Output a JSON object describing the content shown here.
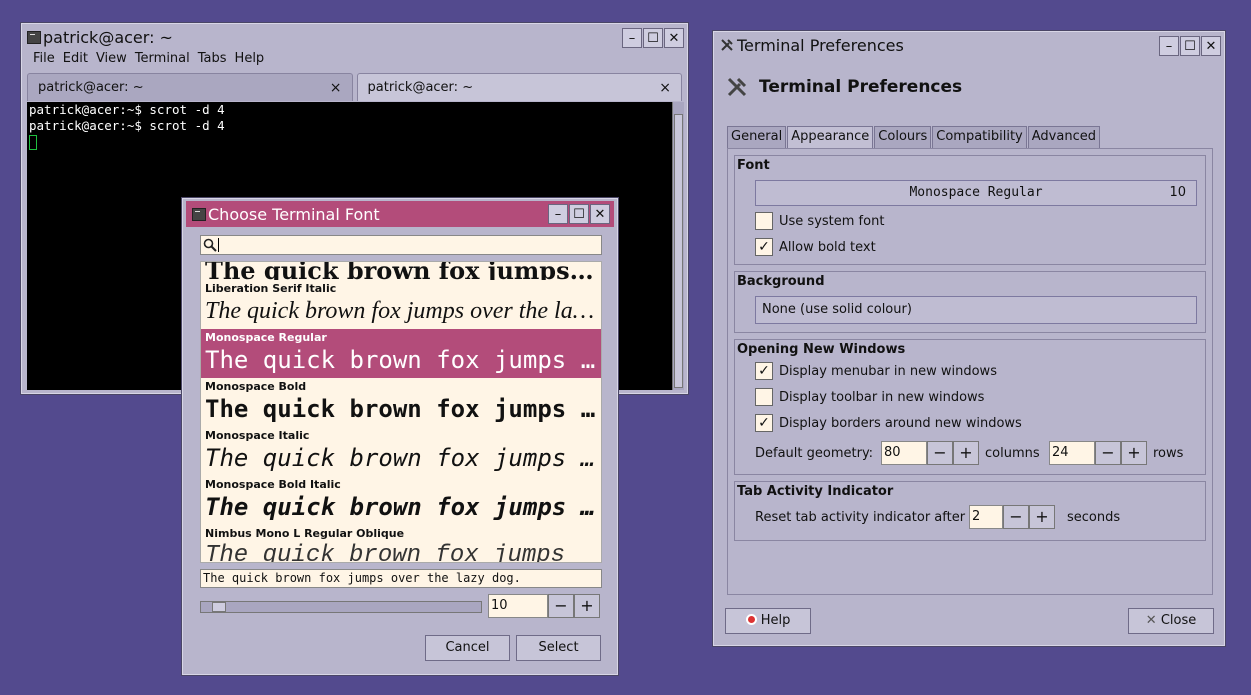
{
  "terminal": {
    "title": "patrick@acer: ~",
    "menu": [
      "File",
      "Edit",
      "View",
      "Terminal",
      "Tabs",
      "Help"
    ],
    "tabs": [
      {
        "label": "patrick@acer: ~",
        "close": "×"
      },
      {
        "label": "patrick@acer: ~",
        "close": "×"
      }
    ],
    "lines": [
      "patrick@acer:~$ scrot -d 4",
      "patrick@acer:~$ scrot -d 4"
    ]
  },
  "window_buttons": {
    "minimize": "–",
    "maximize": "☐",
    "close": "✕"
  },
  "font_chooser": {
    "title": "Choose Terminal Font",
    "search_value": "",
    "fonts": [
      {
        "name": "",
        "sample": "The quick brown fox jumps over the lazy dog"
      },
      {
        "name": "Liberation Serif Italic",
        "sample": "The quick brown fox jumps over the lazy dog"
      },
      {
        "name": "Monospace Regular",
        "sample": "The quick brown fox jumps over the lazy dog"
      },
      {
        "name": "Monospace Bold",
        "sample": "The quick brown fox jumps over the lazy dog"
      },
      {
        "name": "Monospace Italic",
        "sample": "The quick brown fox jumps over the lazy dog"
      },
      {
        "name": "Monospace Bold Italic",
        "sample": "The quick brown fox jumps over the lazy dog"
      },
      {
        "name": "Nimbus Mono L Regular Oblique",
        "sample": "The quick brown fox jumps"
      }
    ],
    "preview_text": "The quick brown fox jumps over the lazy dog.",
    "size_value": "10",
    "size_slider_fraction": 0.04,
    "minus": "−",
    "plus": "+",
    "cancel_label": "Cancel",
    "select_label": "Select"
  },
  "prefs": {
    "title": "Terminal Preferences",
    "heading": "Terminal Preferences",
    "tabs": [
      "General",
      "Appearance",
      "Colours",
      "Compatibility",
      "Advanced"
    ],
    "font_section": "Font",
    "font_name": "Monospace Regular",
    "font_size": "10",
    "use_system_font": "Use system font",
    "allow_bold": "Allow bold text",
    "background_section": "Background",
    "background_value": "None (use solid colour)",
    "opening_section": "Opening New Windows",
    "display_menubar": "Display menubar in new windows",
    "display_toolbar": "Display toolbar in new windows",
    "display_borders": "Display borders around new windows",
    "geometry_label": "Default geometry:",
    "columns_value": "80",
    "columns_label": "columns",
    "rows_value": "24",
    "rows_label": "rows",
    "tab_activity_section": "Tab Activity Indicator",
    "reset_label": "Reset tab activity indicator after",
    "reset_value": "2",
    "seconds_label": "seconds",
    "help_label": "Help",
    "close_label": "Close",
    "check_mark": "✓",
    "minus": "−",
    "plus": "+"
  },
  "colors": {
    "desktop": "#534a8e",
    "accent": "#b34c7a",
    "window": "#b8b5cc"
  }
}
